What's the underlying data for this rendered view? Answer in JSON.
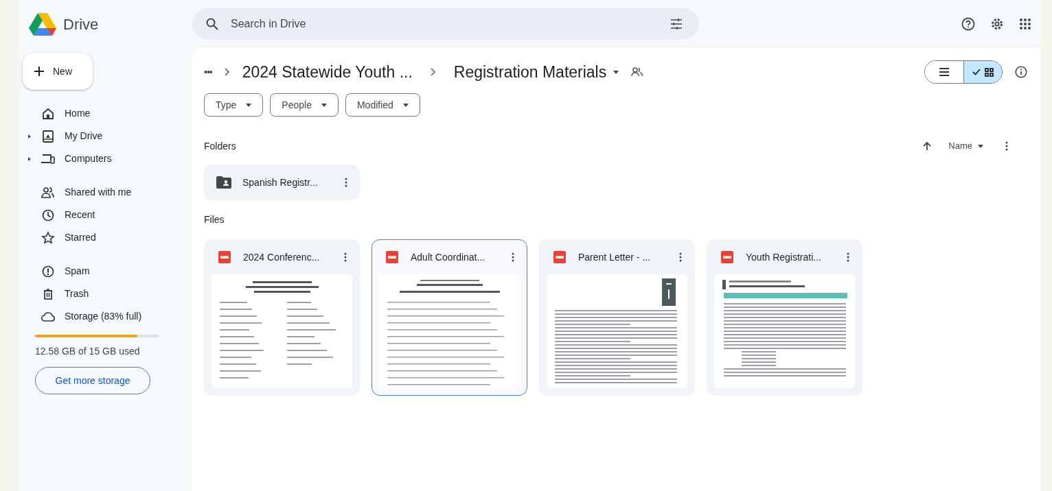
{
  "app": {
    "title": "Drive"
  },
  "search": {
    "placeholder": "Search in Drive"
  },
  "new_button": {
    "label": "New"
  },
  "sidebar": {
    "items": [
      {
        "label": "Home",
        "expandable": false
      },
      {
        "label": "My Drive",
        "expandable": true
      },
      {
        "label": "Computers",
        "expandable": true
      },
      {
        "label": "Shared with me",
        "expandable": false
      },
      {
        "label": "Recent",
        "expandable": false
      },
      {
        "label": "Starred",
        "expandable": false
      },
      {
        "label": "Spam",
        "expandable": false
      },
      {
        "label": "Trash",
        "expandable": false
      },
      {
        "label": "Storage (83% full)",
        "expandable": false
      }
    ]
  },
  "storage": {
    "level": 0.83,
    "usage": "12.58 GB of 15 GB used",
    "button": "Get more storage"
  },
  "breadcrumb": {
    "overflow": "•••",
    "parent": "2024 Statewide Youth ...",
    "current": "Registration Materials"
  },
  "view_toggle": [
    {
      "kind": "list",
      "selected": false
    },
    {
      "kind": "grid",
      "selected": true
    }
  ],
  "filters": [
    "Type",
    "People",
    "Modified"
  ],
  "sort": {
    "label": "Name"
  },
  "folders_heading": "Folders",
  "folders": [
    {
      "name": "Spanish Registr..."
    }
  ],
  "files_heading": "Files",
  "files": [
    {
      "name": "2024 Conferenc...",
      "selected": false
    },
    {
      "name": "Adult Coordinat...",
      "selected": true
    },
    {
      "name": "Parent Letter - ...",
      "selected": false
    },
    {
      "name": "Youth Registrati...",
      "selected": false
    }
  ]
}
